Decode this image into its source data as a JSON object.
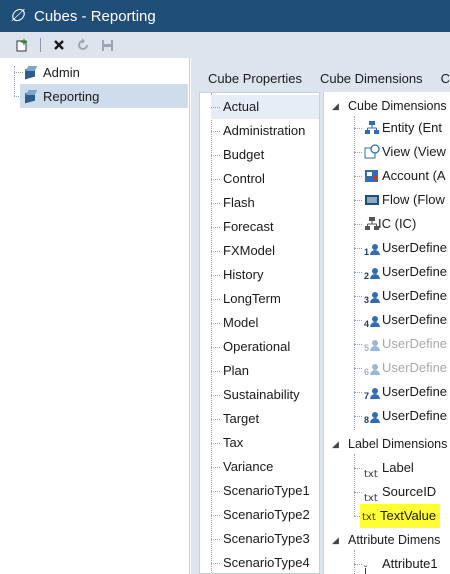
{
  "window": {
    "title": "Cubes - Reporting"
  },
  "toolbar": {
    "buttons": [
      "new-cube",
      "delete",
      "refresh",
      "save"
    ]
  },
  "tree": {
    "items": [
      {
        "label": "Admin"
      },
      {
        "label": "Reporting",
        "selected": true
      }
    ]
  },
  "tabs": [
    {
      "label": "Cube Properties"
    },
    {
      "label": "Cube Dimensions"
    },
    {
      "label": "C"
    }
  ],
  "scenarios": [
    "Actual",
    "Administration",
    "Budget",
    "Control",
    "Flash",
    "Forecast",
    "FXModel",
    "History",
    "LongTerm",
    "Model",
    "Operational",
    "Plan",
    "Sustainability",
    "Target",
    "Tax",
    "Variance",
    "ScenarioType1",
    "ScenarioType2",
    "ScenarioType3",
    "ScenarioType4"
  ],
  "selected_scenario": "Actual",
  "dimension_groups": {
    "cube": {
      "label": "Cube Dimensions"
    },
    "label": {
      "label": "Label Dimensions"
    },
    "attribute": {
      "label": "Attribute Dimens"
    }
  },
  "cube_dimensions": [
    {
      "label": "Entity  (Ent",
      "icon": "entity-icon"
    },
    {
      "label": "View  (View",
      "icon": "view-icon"
    },
    {
      "label": "Account  (A",
      "icon": "account-icon"
    },
    {
      "label": "Flow  (Flow",
      "icon": "flow-icon"
    },
    {
      "label": "IC  (IC)",
      "icon": "ic-icon"
    },
    {
      "label": "UserDefine",
      "num": "1",
      "disabled": false
    },
    {
      "label": "UserDefine",
      "num": "2",
      "disabled": false
    },
    {
      "label": "UserDefine",
      "num": "3",
      "disabled": false
    },
    {
      "label": "UserDefine",
      "num": "4",
      "disabled": false
    },
    {
      "label": "UserDefine",
      "num": "5",
      "disabled": true
    },
    {
      "label": "UserDefine",
      "num": "6",
      "disabled": true
    },
    {
      "label": "UserDefine",
      "num": "7",
      "disabled": false
    },
    {
      "label": "UserDefine",
      "num": "8",
      "disabled": false
    }
  ],
  "label_dimensions": [
    {
      "label": "Label"
    },
    {
      "label": "SourceID"
    },
    {
      "label": "TextValue",
      "highlighted": true
    }
  ],
  "attribute_dimensions": [
    {
      "label": "Attribute1"
    }
  ],
  "colors": {
    "titlebar": "#1f4e79",
    "pane": "#dde4ee",
    "highlight": "#ffff33",
    "selection": "#e6edf7"
  }
}
